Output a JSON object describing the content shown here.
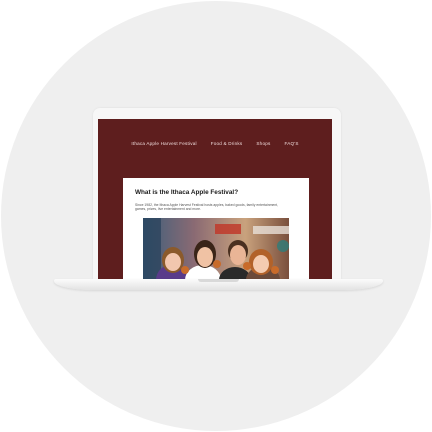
{
  "nav": {
    "items": [
      {
        "label": "Ithaca Apple Harvest Festival"
      },
      {
        "label": "Food & Drinks"
      },
      {
        "label": "Shops"
      },
      {
        "label": "FAQ'S"
      }
    ]
  },
  "article": {
    "heading": "What is the Ithaca Apple Festival?",
    "body": "Since 1982, the Ithaca Apple Harvest Festival hosts apples, baked goods, family entertainment, games, prizes, live entertainment and more."
  },
  "colors": {
    "brand": "#5e1e1e",
    "card": "#ffffff",
    "background": "#efefef"
  }
}
